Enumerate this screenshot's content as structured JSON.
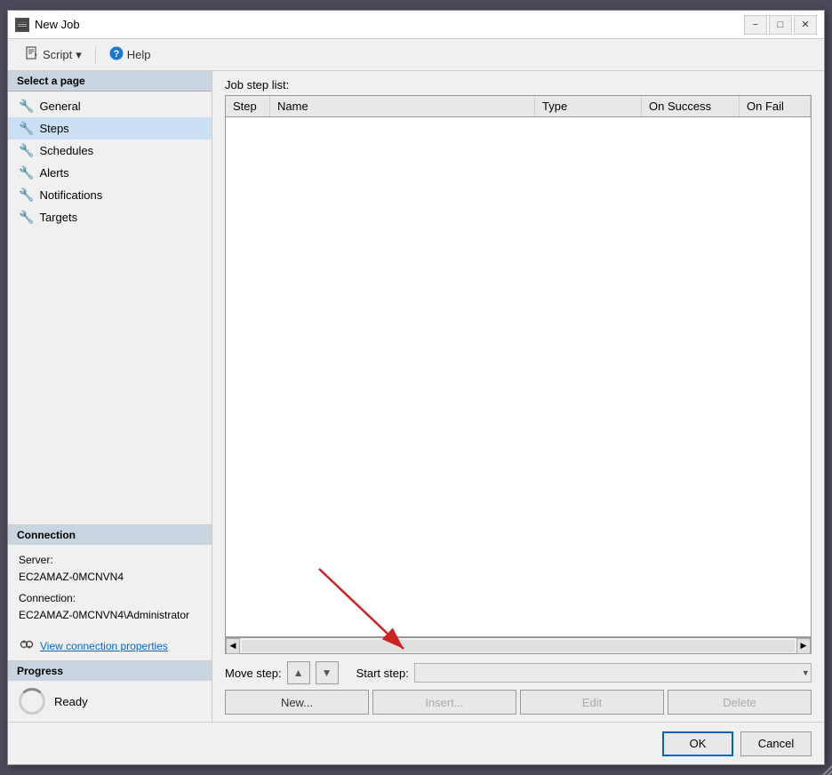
{
  "window": {
    "title": "New Job",
    "icon": "⊞"
  },
  "toolbar": {
    "script_label": "Script",
    "script_dropdown": "▾",
    "help_label": "Help"
  },
  "sidebar": {
    "section_header": "Select a page",
    "items": [
      {
        "id": "general",
        "label": "General"
      },
      {
        "id": "steps",
        "label": "Steps"
      },
      {
        "id": "schedules",
        "label": "Schedules"
      },
      {
        "id": "alerts",
        "label": "Alerts"
      },
      {
        "id": "notifications",
        "label": "Notifications"
      },
      {
        "id": "targets",
        "label": "Targets"
      }
    ]
  },
  "connection": {
    "header": "Connection",
    "server_label": "Server:",
    "server_value": "EC2AMAZ-0MCNVN4",
    "connection_label": "Connection:",
    "connection_value": "EC2AMAZ-0MCNVN4\\Administrator",
    "view_link": "View connection properties"
  },
  "progress": {
    "header": "Progress",
    "status": "Ready"
  },
  "main": {
    "panel_label": "Job step list:",
    "table": {
      "columns": [
        "Step",
        "Name",
        "Type",
        "On Success",
        "On Fail"
      ]
    }
  },
  "controls": {
    "move_step_label": "Move step:",
    "move_up_label": "▲",
    "move_down_label": "▼",
    "start_step_label": "Start step:",
    "buttons": {
      "new": "New...",
      "insert": "Insert...",
      "edit": "Edit",
      "delete": "Delete"
    }
  },
  "footer": {
    "ok_label": "OK",
    "cancel_label": "Cancel"
  }
}
